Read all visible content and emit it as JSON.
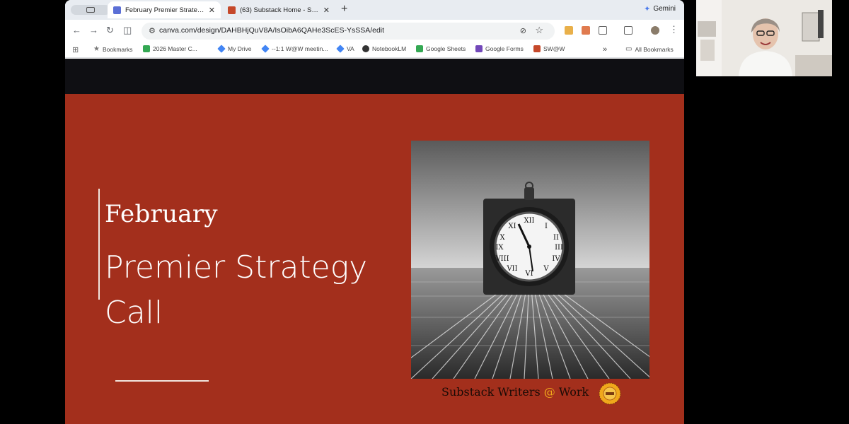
{
  "browser": {
    "tabs": [
      {
        "title": "February Premier Strategy Call",
        "active": true,
        "favicon_color": "#5b6fd6"
      },
      {
        "title": "(63) Substack Home - Substack",
        "active": false,
        "favicon_color": "#c5482a"
      }
    ],
    "new_tab_label": "+",
    "gemini_label": "Gemini",
    "url": "canva.com/design/DAHBHjQuV8A/IsOibA6QAHe3ScES-YsSSA/edit"
  },
  "bookmarks": {
    "items": [
      {
        "label": "Bookmarks",
        "color": "#777777"
      },
      {
        "label": "2026 Master C...",
        "color": "#34a853"
      },
      {
        "label": "My Drive",
        "color": "#4285f4"
      },
      {
        "label": "--1:1 W@W meetin...",
        "color": "#4285f4"
      },
      {
        "label": "VA",
        "color": "#4285f4"
      },
      {
        "label": "NotebookLM",
        "color": "#333333"
      },
      {
        "label": "Google Sheets",
        "color": "#34a853"
      },
      {
        "label": "Google Forms",
        "color": "#7248b9"
      },
      {
        "label": "SW@W",
        "color": "#c5482a"
      }
    ],
    "more_label": "»",
    "all_bookmarks_label": "All Bookmarks"
  },
  "slide": {
    "kicker": "February",
    "headline": "Premier Strategy Call",
    "caption_before": "Substack Writers ",
    "caption_at": "@",
    "caption_after": " Work",
    "background_color": "#a32f1c"
  }
}
